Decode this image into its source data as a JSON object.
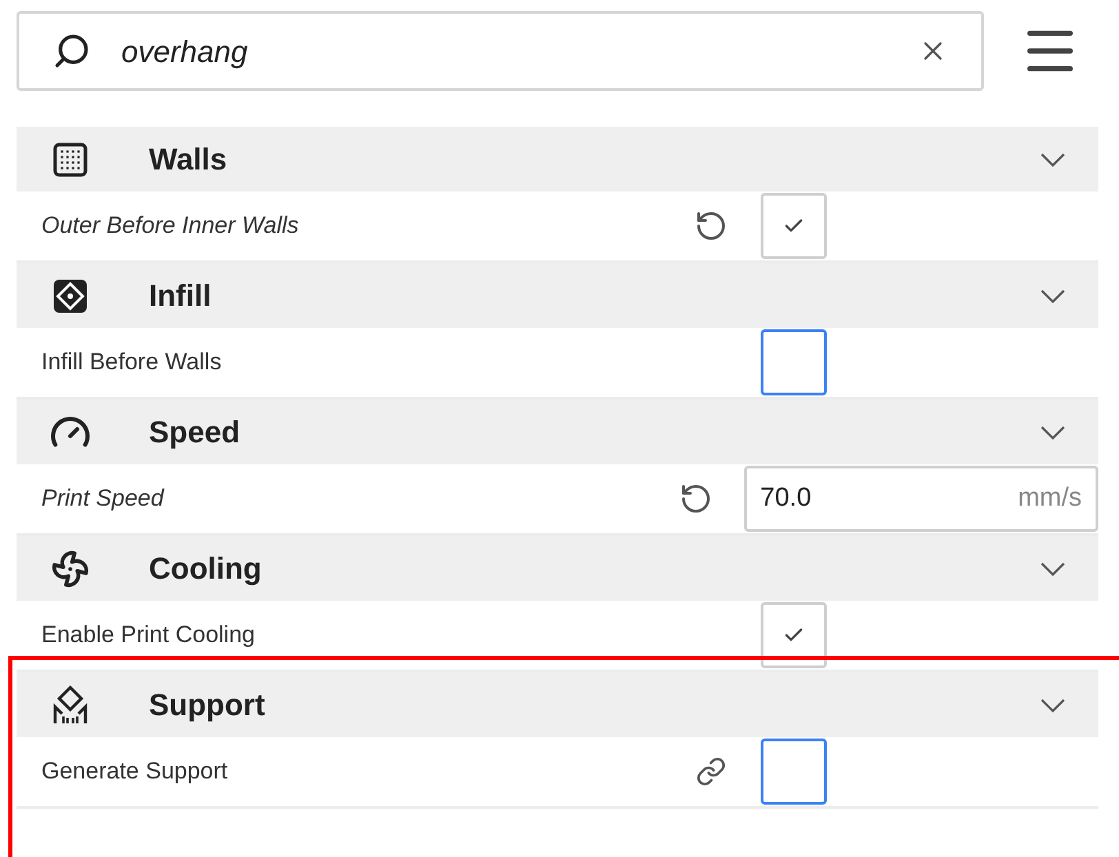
{
  "search": {
    "value": "overhang"
  },
  "sections": [
    {
      "kind": "walls",
      "title": "Walls",
      "highlighted": false,
      "settings": [
        {
          "label": "Outer Before Inner Walls",
          "modified": true,
          "indicator": {
            "kind": "reset"
          },
          "kind": "checkbox",
          "checked": true
        }
      ]
    },
    {
      "kind": "infill",
      "title": "Infill",
      "highlighted": false,
      "settings": [
        {
          "label": "Infill Before Walls",
          "modified": false,
          "kind": "checkbox",
          "checked": false
        }
      ]
    },
    {
      "kind": "speed",
      "title": "Speed",
      "highlighted": false,
      "settings": [
        {
          "label": "Print Speed",
          "modified": true,
          "indicator": {
            "kind": "reset"
          },
          "kind": "number",
          "value": "70.0",
          "unit": "mm/s"
        }
      ]
    },
    {
      "kind": "cooling",
      "title": "Cooling",
      "highlighted": false,
      "settings": [
        {
          "label": "Enable Print Cooling",
          "modified": false,
          "kind": "checkbox",
          "checked": true
        }
      ]
    },
    {
      "kind": "support",
      "title": "Support",
      "highlighted": true,
      "settings": [
        {
          "label": "Generate Support",
          "modified": false,
          "indicator": {
            "kind": "link"
          },
          "kind": "checkbox",
          "checked": false
        }
      ]
    }
  ]
}
